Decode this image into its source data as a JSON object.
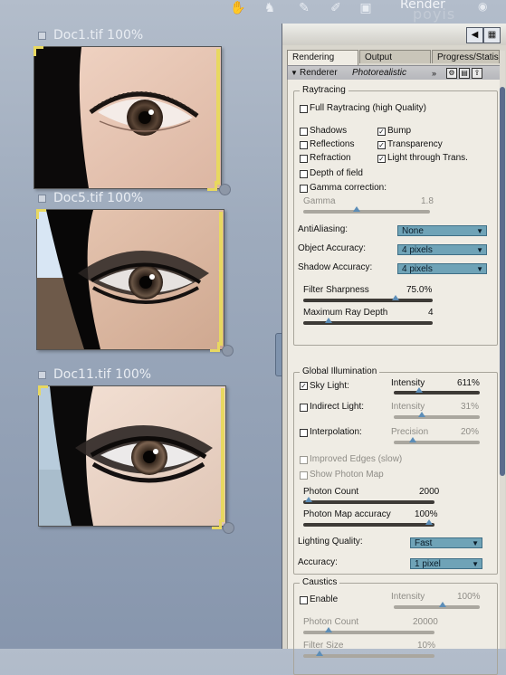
{
  "toolbar": {
    "title": "Render",
    "watermark": "poyis",
    "icons": [
      "hand-icon",
      "body-icon",
      "brush-icon",
      "pencil-icon",
      "render-icon",
      "eye-icon"
    ]
  },
  "documents": [
    {
      "title": "Doc1.tif 100%"
    },
    {
      "title": "Doc5.tif 100%"
    },
    {
      "title": "Doc11.tif 100%"
    }
  ],
  "panel": {
    "tabs": [
      "Rendering",
      "Output",
      "Progress/Statis"
    ],
    "active_tab": "Rendering",
    "renderer_label": "Renderer",
    "renderer_value": "Photorealistic",
    "raytracing": {
      "label": "Raytracing",
      "full_raytracing": "Full Raytracing (high Quality)",
      "shadows": "Shadows",
      "bump": "Bump",
      "reflections": "Reflections",
      "transparency": "Transparency",
      "refraction": "Refraction",
      "light_through_trans": "Light through Trans.",
      "depth_of_field": "Depth of field",
      "gamma_correction": "Gamma correction:",
      "gamma_label": "Gamma",
      "gamma_value": "1.8",
      "antialiasing_label": "AntiAliasing:",
      "antialiasing_value": "None",
      "object_accuracy_label": "Object Accuracy:",
      "object_accuracy_value": "4 pixels",
      "shadow_accuracy_label": "Shadow Accuracy:",
      "shadow_accuracy_value": "4 pixels",
      "filter_sharpness_label": "Filter Sharpness",
      "filter_sharpness_value": "75.0%",
      "max_ray_depth_label": "Maximum Ray Depth",
      "max_ray_depth_value": "4",
      "checked": {
        "bump": true,
        "transparency": true,
        "light_through_trans": true
      }
    },
    "global_illumination": {
      "label": "Global Illumination",
      "sky_light": "Sky Light:",
      "intensity_label": "Intensity",
      "sky_intensity_value": "611%",
      "indirect_light": "Indirect Light:",
      "indirect_intensity_value": "31%",
      "interpolation": "Interpolation:",
      "precision_label": "Precision",
      "precision_value": "20%",
      "improved_edges": "Improved Edges (slow)",
      "show_photon_map": "Show Photon Map",
      "photon_count_label": "Photon Count",
      "photon_count_value": "2000",
      "photon_map_accuracy_label": "Photon Map accuracy",
      "photon_map_accuracy_value": "100%",
      "lighting_quality_label": "Lighting Quality:",
      "lighting_quality_value": "Fast",
      "accuracy_label": "Accuracy:",
      "accuracy_value": "1 pixel",
      "checked": {
        "sky_light": true
      }
    },
    "caustics": {
      "label": "Caustics",
      "enable": "Enable",
      "intensity_label": "Intensity",
      "intensity_value": "100%",
      "photon_count_label": "Photon Count",
      "photon_count_value": "20000",
      "filter_size_label": "Filter Size",
      "filter_size_value": "10%"
    },
    "colors": {
      "accent_dropdown": "#6fa3b7",
      "slider_knob": "#5c8db7",
      "panel_bg": "#efece4"
    }
  }
}
